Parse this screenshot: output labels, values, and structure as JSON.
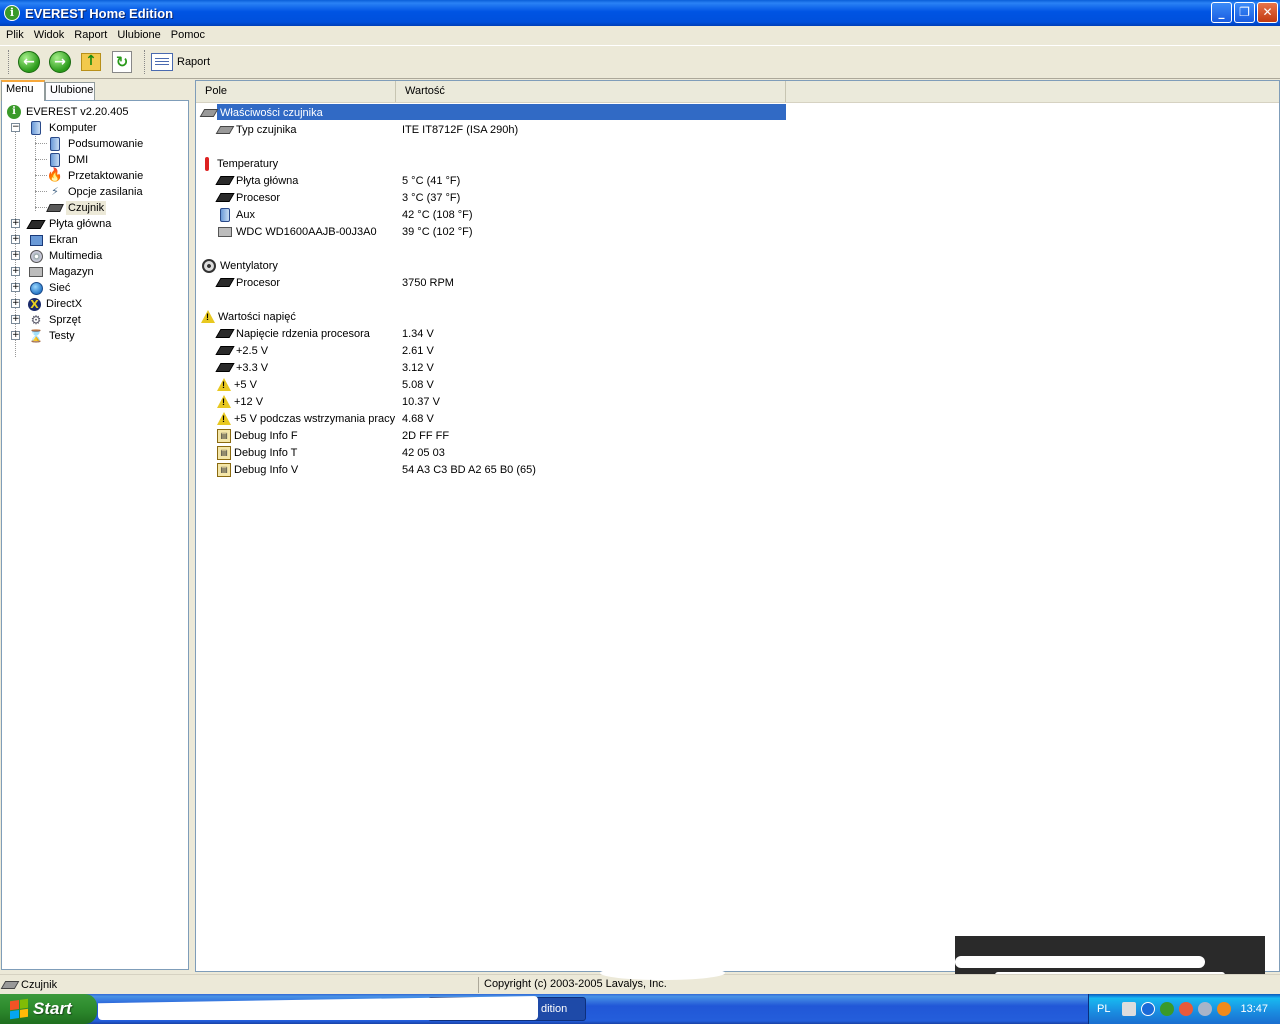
{
  "window": {
    "title": "EVEREST Home Edition",
    "minimize": "_",
    "maximize": "❐",
    "close": "✕"
  },
  "menu": [
    "Plik",
    "Widok",
    "Raport",
    "Ulubione",
    "Pomoc"
  ],
  "toolbar": {
    "report_label": "Raport"
  },
  "left_tabs": [
    "Menu",
    "Ulubione"
  ],
  "tree": {
    "root": "EVEREST v2.20.405",
    "komputer": "Komputer",
    "komputer_children": [
      "Podsumowanie",
      "DMI",
      "Przetaktowanie",
      "Opcje zasilania",
      "Czujnik"
    ],
    "top_items": [
      "Płyta główna",
      "Ekran",
      "Multimedia",
      "Magazyn",
      "Sieć",
      "DirectX",
      "Sprzęt",
      "Testy"
    ]
  },
  "columns": {
    "field": "Pole",
    "value": "Wartość"
  },
  "groups": {
    "sensor_props": "Właściwości czujnika",
    "temperatures": "Temperatury",
    "fans": "Wentylatory",
    "voltages": "Wartości napięć"
  },
  "rows": {
    "sensor_type": {
      "field": "Typ czujnika",
      "value": "ITE IT8712F  (ISA 290h)"
    },
    "temp_mb": {
      "field": "Płyta główna",
      "value": "5 °C  (41 °F)"
    },
    "temp_cpu": {
      "field": "Procesor",
      "value": "3 °C  (37 °F)"
    },
    "temp_aux": {
      "field": "Aux",
      "value": "42 °C  (108 °F)"
    },
    "temp_hdd": {
      "field": "WDC WD1600AAJB-00J3A0",
      "value": "39 °C  (102 °F)"
    },
    "fan_cpu": {
      "field": "Procesor",
      "value": "3750 RPM"
    },
    "v_core": {
      "field": "Napięcie rdzenia procesora",
      "value": "1.34 V"
    },
    "v_25": {
      "field": "+2.5 V",
      "value": "2.61 V"
    },
    "v_33": {
      "field": "+3.3 V",
      "value": "3.12 V"
    },
    "v_5": {
      "field": "+5 V",
      "value": "5.08 V"
    },
    "v_12": {
      "field": "+12 V",
      "value": "10.37 V"
    },
    "v_5sb": {
      "field": "+5 V podczas wstrzymania pracy",
      "value": "4.68 V"
    },
    "dbg_f": {
      "field": "Debug Info F",
      "value": "2D FF FF"
    },
    "dbg_t": {
      "field": "Debug Info T",
      "value": "42 05 03"
    },
    "dbg_v": {
      "field": "Debug Info V",
      "value": "54 A3 C3 BD A2 65 B0 (65)"
    }
  },
  "status": {
    "left": "Czujnik",
    "right": "Copyright (c) 2003-2005 Lavalys, Inc."
  },
  "taskbar": {
    "start": "Start",
    "task_fragment": "dition",
    "lang": "PL",
    "clock": "13:47"
  }
}
